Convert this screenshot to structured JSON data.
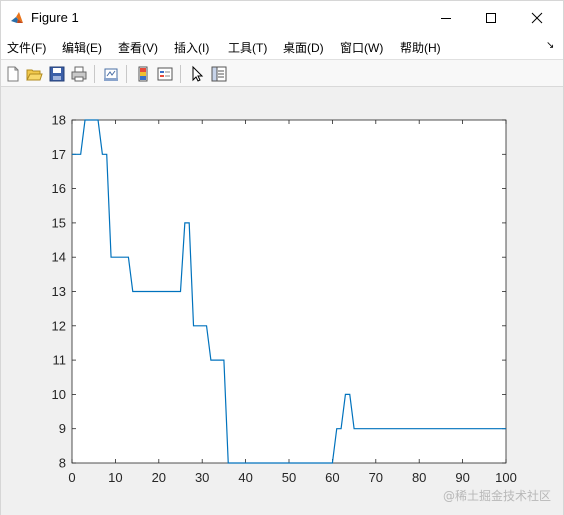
{
  "window": {
    "title": "Figure 1",
    "controls": {
      "minimize": "—",
      "maximize": "☐",
      "close": "✕"
    }
  },
  "menu": {
    "items": [
      "文件(F)",
      "编辑(E)",
      "查看(V)",
      "插入(I)",
      "工具(T)",
      "桌面(D)",
      "窗口(W)",
      "帮助(H)"
    ],
    "overflow_glyph": "↘"
  },
  "toolbar": {
    "buttons": [
      "new-figure-icon",
      "open-file-icon",
      "save-icon",
      "print-icon",
      "link-plot-icon",
      "insert-colorbar-icon",
      "insert-legend-icon",
      "pointer-icon",
      "property-inspector-icon"
    ]
  },
  "watermark": "@稀土掘金技术社区",
  "colors": {
    "line": "#0072bd",
    "axes_bg": "#ffffff",
    "figure_bg": "#f0f0f0"
  },
  "chart_data": {
    "type": "line",
    "title": "",
    "xlabel": "",
    "ylabel": "",
    "xlim": [
      0,
      100
    ],
    "ylim": [
      8,
      18
    ],
    "xticks": [
      0,
      10,
      20,
      30,
      40,
      50,
      60,
      70,
      80,
      90,
      100
    ],
    "yticks": [
      8,
      9,
      10,
      11,
      12,
      13,
      14,
      15,
      16,
      17,
      18
    ],
    "grid": false,
    "series": [
      {
        "name": "",
        "color": "#0072bd",
        "x": [
          0,
          2,
          3,
          6,
          7,
          8,
          9,
          13,
          14,
          25,
          26,
          27,
          28,
          31,
          32,
          35,
          36,
          60,
          61,
          62,
          63,
          64,
          65,
          100
        ],
        "y": [
          17,
          17,
          18,
          18,
          17,
          17,
          14,
          14,
          13,
          13,
          15,
          15,
          12,
          12,
          11,
          11,
          8,
          8,
          9,
          9,
          10,
          10,
          9,
          9
        ]
      }
    ]
  }
}
